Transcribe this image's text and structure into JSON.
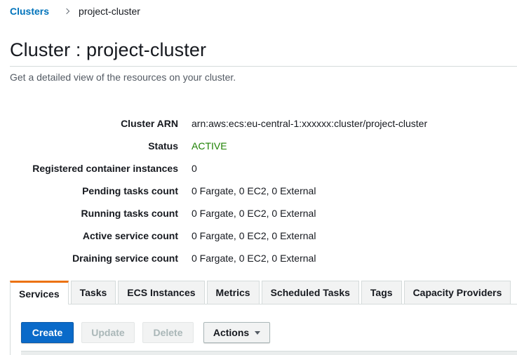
{
  "breadcrumb": {
    "parent_label": "Clusters",
    "current_label": "project-cluster"
  },
  "page": {
    "title": "Cluster : project-cluster",
    "subtitle": "Get a detailed view of the resources on your cluster."
  },
  "details": [
    {
      "label": "Cluster ARN",
      "value": "arn:aws:ecs:eu-central-1:xxxxxx:cluster/project-cluster"
    },
    {
      "label": "Status",
      "value": "ACTIVE"
    },
    {
      "label": "Registered container instances",
      "value": "0"
    },
    {
      "label": "Pending tasks count",
      "value": "0 Fargate, 0 EC2, 0 External"
    },
    {
      "label": "Running tasks count",
      "value": "0 Fargate, 0 EC2, 0 External"
    },
    {
      "label": "Active service count",
      "value": "0 Fargate, 0 EC2, 0 External"
    },
    {
      "label": "Draining service count",
      "value": "0 Fargate, 0 EC2, 0 External"
    }
  ],
  "tabs": [
    {
      "label": "Services",
      "selected": true
    },
    {
      "label": "Tasks"
    },
    {
      "label": "ECS Instances"
    },
    {
      "label": "Metrics"
    },
    {
      "label": "Scheduled Tasks"
    },
    {
      "label": "Tags"
    },
    {
      "label": "Capacity Providers"
    }
  ],
  "toolbar": {
    "create_label": "Create",
    "update_label": "Update",
    "delete_label": "Delete",
    "actions_label": "Actions"
  },
  "colors": {
    "link": "#0073bb",
    "status_active": "#1d8102",
    "primary_button": "#0a6ac9",
    "selected_tab_accent": "#ec7211"
  },
  "icons": {
    "breadcrumb_separator": "chevron-right-icon",
    "actions_dropdown": "caret-down-icon"
  }
}
